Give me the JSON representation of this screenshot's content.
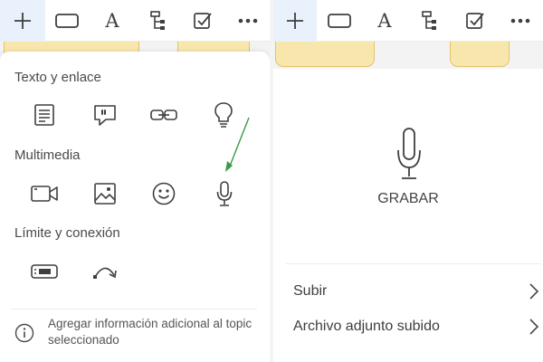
{
  "toolbar": {
    "buttons": [
      {
        "icon": "plus-icon",
        "active": true
      },
      {
        "icon": "topic-shape-icon"
      },
      {
        "icon": "text-style-icon",
        "glyph": "A"
      },
      {
        "icon": "structure-icon"
      },
      {
        "icon": "checkbox-icon"
      },
      {
        "icon": "more-icon"
      }
    ]
  },
  "insert_panel": {
    "sections": [
      {
        "title": "Texto y enlace",
        "items": [
          "notes-icon",
          "comment-icon",
          "link-icon",
          "idea-icon"
        ]
      },
      {
        "title": "Multimedia",
        "items": [
          "video-icon",
          "image-icon",
          "emoji-icon",
          "microphone-icon"
        ]
      },
      {
        "title": "Límite y conexión",
        "items": [
          "boundary-icon",
          "relationship-icon"
        ]
      }
    ],
    "info_text": "Agregar información adicional al topic seleccionado",
    "annotation_arrow_color": "#3a9a45"
  },
  "recording_panel": {
    "record_label": "GRABAR",
    "rows": [
      {
        "label": "Subir"
      },
      {
        "label": "Archivo adjunto subido"
      }
    ]
  },
  "colors": {
    "accent_active": "#e9f1fc",
    "topic_fill": "#f8e7ad",
    "icon_stroke": "#3f3f3f"
  }
}
